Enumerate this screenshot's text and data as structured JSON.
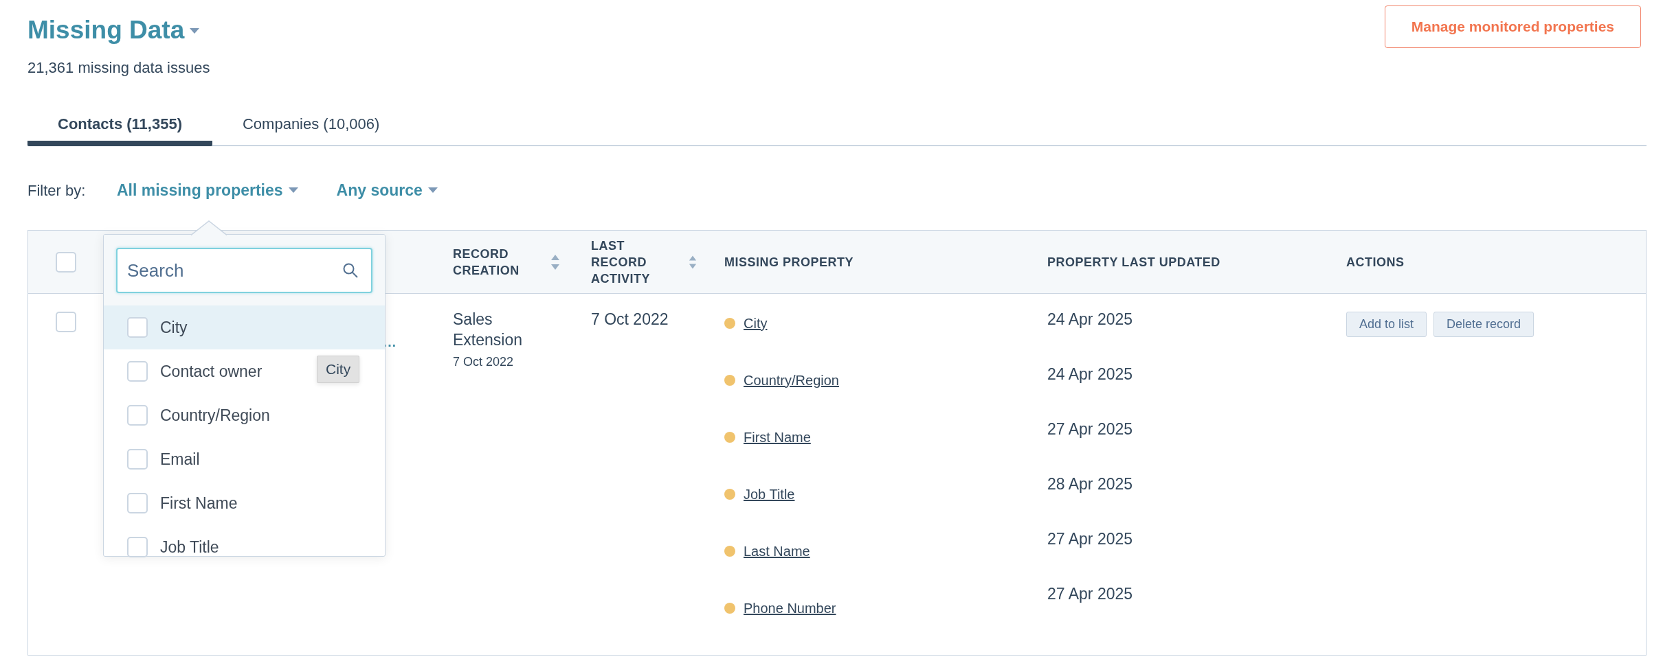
{
  "title": "Missing Data",
  "subtitle": "21,361 missing data issues",
  "manage_button": "Manage monitored properties",
  "tabs": [
    {
      "label": "Contacts (11,355)",
      "selected": true
    },
    {
      "label": "Companies (10,006)",
      "selected": false
    }
  ],
  "filter": {
    "label": "Filter by:",
    "dropdowns": [
      {
        "label": "All missing properties"
      },
      {
        "label": "Any source"
      }
    ]
  },
  "table": {
    "select_all": {
      "checked": false
    },
    "columns": [
      {
        "label": "RECORD CREATION",
        "sortable": true
      },
      {
        "label": "LAST RECORD ACTIVITY",
        "sortable": true
      },
      {
        "label": "MISSING PROPERTY",
        "sortable": false
      },
      {
        "label": "PROPERTY LAST UPDATED",
        "sortable": false
      },
      {
        "label": "ACTIONS",
        "sortable": false
      }
    ],
    "rows": [
      {
        "checked": false,
        "name": "…",
        "source": "Sales Extension",
        "created": "7 Oct 2022",
        "last_activity": "7 Oct 2022",
        "missing": [
          {
            "property": "City",
            "updated": "24 Apr 2025"
          },
          {
            "property": "Country/Region",
            "updated": "24 Apr 2025"
          },
          {
            "property": "First Name",
            "updated": "27 Apr 2025"
          },
          {
            "property": "Job Title",
            "updated": "28 Apr 2025"
          },
          {
            "property": "Last Name",
            "updated": "27 Apr 2025"
          },
          {
            "property": "Phone Number",
            "updated": "27 Apr 2025"
          }
        ],
        "actions": [
          "Add to list",
          "Delete record"
        ]
      }
    ]
  },
  "property_menu": {
    "search": {
      "placeholder": "Search"
    },
    "items": [
      {
        "label": "City",
        "checked": false,
        "highlighted": true
      },
      {
        "label": "Contact owner",
        "checked": false,
        "highlighted": false
      },
      {
        "label": "Country/Region",
        "checked": false,
        "highlighted": false
      },
      {
        "label": "Email",
        "checked": false,
        "highlighted": false
      },
      {
        "label": "First Name",
        "checked": false,
        "highlighted": false
      },
      {
        "label": "Job Title",
        "checked": false,
        "highlighted": false
      }
    ],
    "tooltip": "City"
  }
}
